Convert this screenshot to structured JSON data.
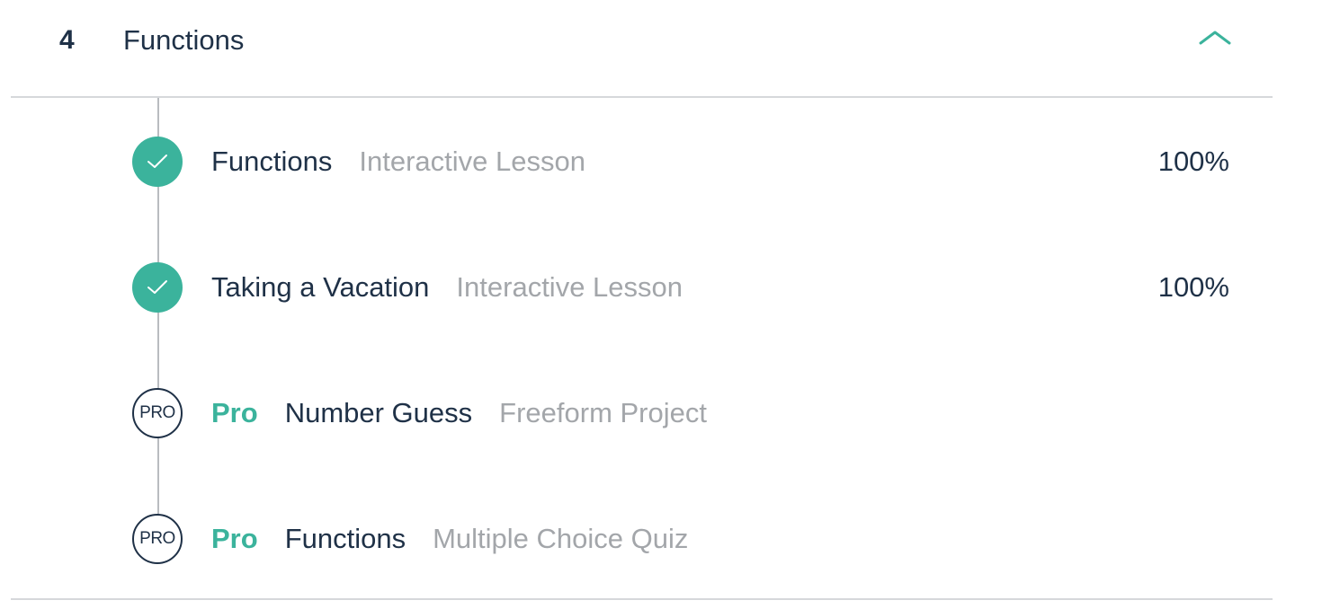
{
  "module": {
    "number": "4",
    "title": "Functions",
    "expanded": true,
    "accent_color": "#3bb39c"
  },
  "lessons": [
    {
      "status": "complete",
      "status_icon": "check-icon",
      "name": "Functions",
      "type": "Interactive Lesson",
      "progress": "100%"
    },
    {
      "status": "complete",
      "status_icon": "check-icon",
      "name": "Taking a Vacation",
      "type": "Interactive Lesson",
      "progress": "100%"
    },
    {
      "status": "pro",
      "badge": "PRO",
      "pro_label": "Pro",
      "name": "Number Guess",
      "type": "Freeform Project"
    },
    {
      "status": "pro",
      "badge": "PRO",
      "pro_label": "Pro",
      "name": "Functions",
      "type": "Multiple Choice Quiz"
    }
  ]
}
